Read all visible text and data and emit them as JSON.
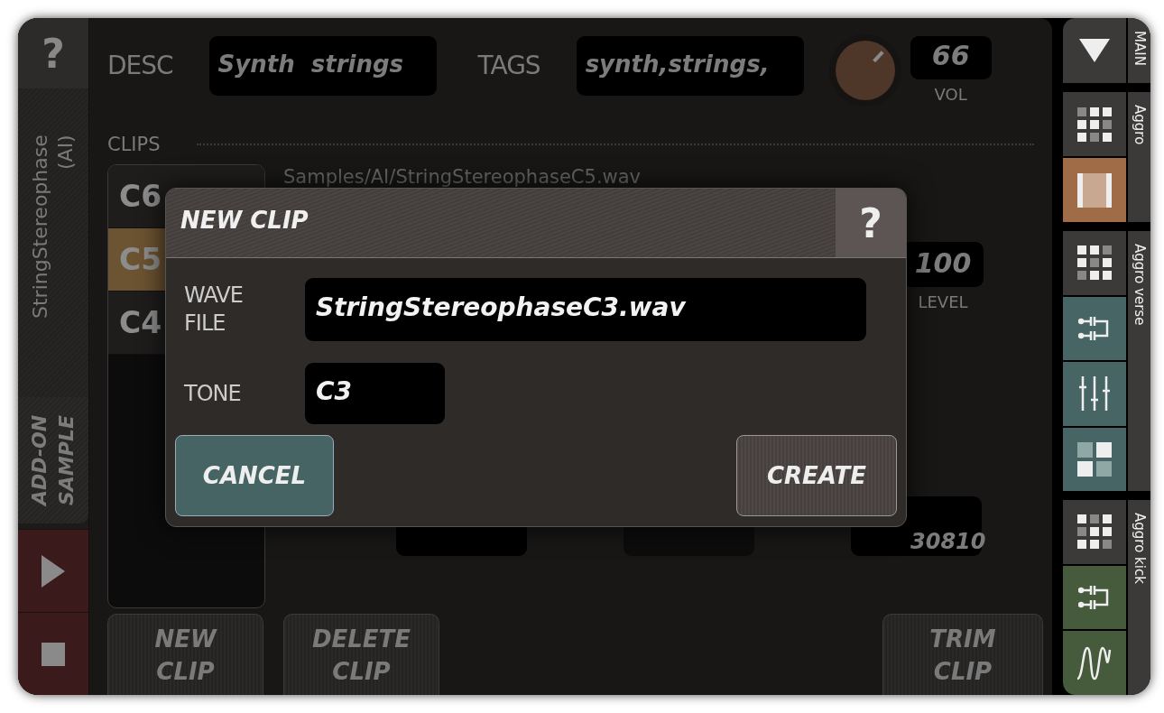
{
  "left_bar": {
    "help": "?",
    "title": "StringStereophase (AI)",
    "addon_button": "ADD-ON SAMPLE",
    "play": {
      "selected": false
    },
    "stop": {
      "selected": false
    }
  },
  "header": {
    "desc_label": "DESC",
    "desc": "Synth  strings",
    "tags_label": "TAGS",
    "tags": "synth,strings,",
    "volume": {
      "level": 0.66,
      "value": "66",
      "label": "VOL"
    }
  },
  "clips_label": "CLIPS",
  "clips": [
    {
      "tone": "C6",
      "selected": false
    },
    {
      "tone": "C5",
      "selected": true
    },
    {
      "tone": "C4",
      "selected": false
    }
  ],
  "clip_detail": {
    "path": "Samples/AI/StringStereophaseC5.wav",
    "level": "100",
    "level_label": "LEVEL",
    "rel": "30810"
  },
  "actions": [
    "NEW CLIP",
    "DELETE CLIP",
    "TRIM CLIP"
  ],
  "dialog": {
    "title": "NEW CLIP",
    "help": "?",
    "wave_label": "WAVE FILE",
    "wave_file": "StringStereophaseC3.wav",
    "tone_label": "TONE",
    "tone": "C3",
    "cancel": "CANCEL",
    "create": "CREATE"
  },
  "sidebar": [
    {
      "label": "MAIN",
      "items": [
        {
          "kind": "dropdown",
          "color": "#3c3a39"
        }
      ]
    },
    {
      "label": "Aggro",
      "items": [
        {
          "kind": "grid",
          "color": "#3c3a39"
        },
        {
          "kind": "clip",
          "color": "#a06c48"
        }
      ]
    },
    {
      "label": "Aggro verse",
      "items": [
        {
          "kind": "grid",
          "color": "#3c3a39"
        },
        {
          "kind": "split",
          "color": "#466564"
        },
        {
          "kind": "mixer",
          "color": "#466564"
        },
        {
          "kind": "pads",
          "color": "#466564"
        }
      ]
    },
    {
      "label": "Aggro kick",
      "items": [
        {
          "kind": "grid",
          "color": "#3c3a39"
        },
        {
          "kind": "split",
          "color": "#465a3c"
        },
        {
          "kind": "wave",
          "color": "#465a3c"
        }
      ]
    }
  ]
}
